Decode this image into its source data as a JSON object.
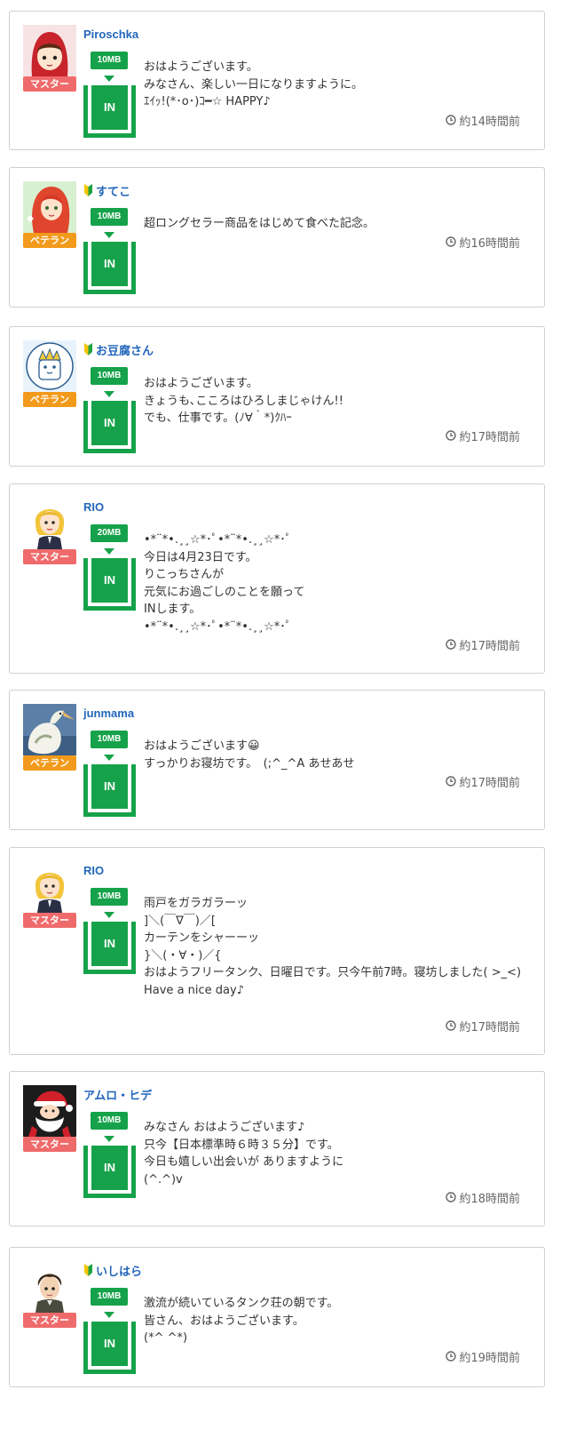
{
  "posts": [
    {
      "username": "Piroschka",
      "rank": "マスター",
      "rank_type": "master",
      "beginner": false,
      "avatar": "red-hood-girl-avatar",
      "size": "10MB",
      "in_label": "IN",
      "message": [
        "おはようございます。",
        "みなさん、楽しい一日になりますように。",
        "ｴｲｯ!(*･o･)ｺ━☆ HAPPY♪"
      ],
      "time": "約14時間前"
    },
    {
      "username": "すてこ",
      "rank": "ベテラン",
      "rank_type": "veteran",
      "beginner": true,
      "avatar": "red-hair-girl-avatar",
      "size": "10MB",
      "in_label": "IN",
      "message": [
        "超ロングセラー商品をはじめて食べた記念。"
      ],
      "time": "約16時間前"
    },
    {
      "username": "お豆腐さん",
      "rank": "ベテラン",
      "rank_type": "veteran",
      "beginner": true,
      "avatar": "crown-mascot-avatar",
      "size": "10MB",
      "in_label": "IN",
      "message": [
        "おはようございます。",
        "きょうも､こころはひろしまじゃけん!!",
        "でも、仕事です。(ﾉ∀｀*)ｸﾊｰ"
      ],
      "time": "約17時間前"
    },
    {
      "username": "RIO",
      "rank": "マスター",
      "rank_type": "master",
      "beginner": false,
      "avatar": "blonde-woman-avatar",
      "size": "20MB",
      "in_label": "IN",
      "message": [
        "•*¨*•.¸¸☆*･ﾟ•*¨*•.¸¸☆*･ﾟ",
        "今日は4月23日です。",
        "りこっちさんが",
        "元気にお過ごしのことを願って",
        "INします。",
        "•*¨*•.¸¸☆*･ﾟ•*¨*•.¸¸☆*･ﾟ"
      ],
      "time": "約17時間前"
    },
    {
      "username": "junmama",
      "rank": "ベテラン",
      "rank_type": "veteran",
      "beginner": false,
      "avatar": "pelican-photo-avatar",
      "size": "10MB",
      "in_label": "IN",
      "message": [
        "おはようございます😀",
        "すっかりお寝坊です。　(;^_^A あせあせ"
      ],
      "time": "約17時間前"
    },
    {
      "username": "RIO",
      "rank": "マスター",
      "rank_type": "master",
      "beginner": false,
      "avatar": "blonde-woman-avatar",
      "size": "10MB",
      "in_label": "IN",
      "message": [
        "雨戸をガラガラーッ",
        "]＼(￣∇￣)／[",
        "カーテンをシャーーッ",
        "}＼(・∀・)／{",
        "おはようフリータンク、日曜日です。只今午前7時。寝坊しました( >_<)",
        "Have a nice day♪"
      ],
      "time": "約17時間前"
    },
    {
      "username": "アムロ・ヒデ",
      "rank": "マスター",
      "rank_type": "master",
      "beginner": false,
      "avatar": "santa-claus-avatar",
      "size": "10MB",
      "in_label": "IN",
      "message": [
        "みなさん おはようございます♪",
        "只今【日本標準時６時３５分】です。",
        "今日も嬉しい出会いが ありますように",
        "(^.^)v"
      ],
      "time": "約18時間前"
    },
    {
      "username": "いしはら",
      "rank": "マスター",
      "rank_type": "master",
      "beginner": true,
      "avatar": "dark-hair-man-avatar",
      "size": "10MB",
      "in_label": "IN",
      "message": [
        "激流が続いているタンク荘の朝です。",
        "皆さん、おはようございます。",
        "(*^ ^*)"
      ],
      "time": "約19時間前"
    }
  ],
  "colors": {
    "accent_green": "#16a24a",
    "username_blue": "#2266bb",
    "master_red": "#ef6b6b",
    "veteran_orange": "#f29a1b"
  }
}
